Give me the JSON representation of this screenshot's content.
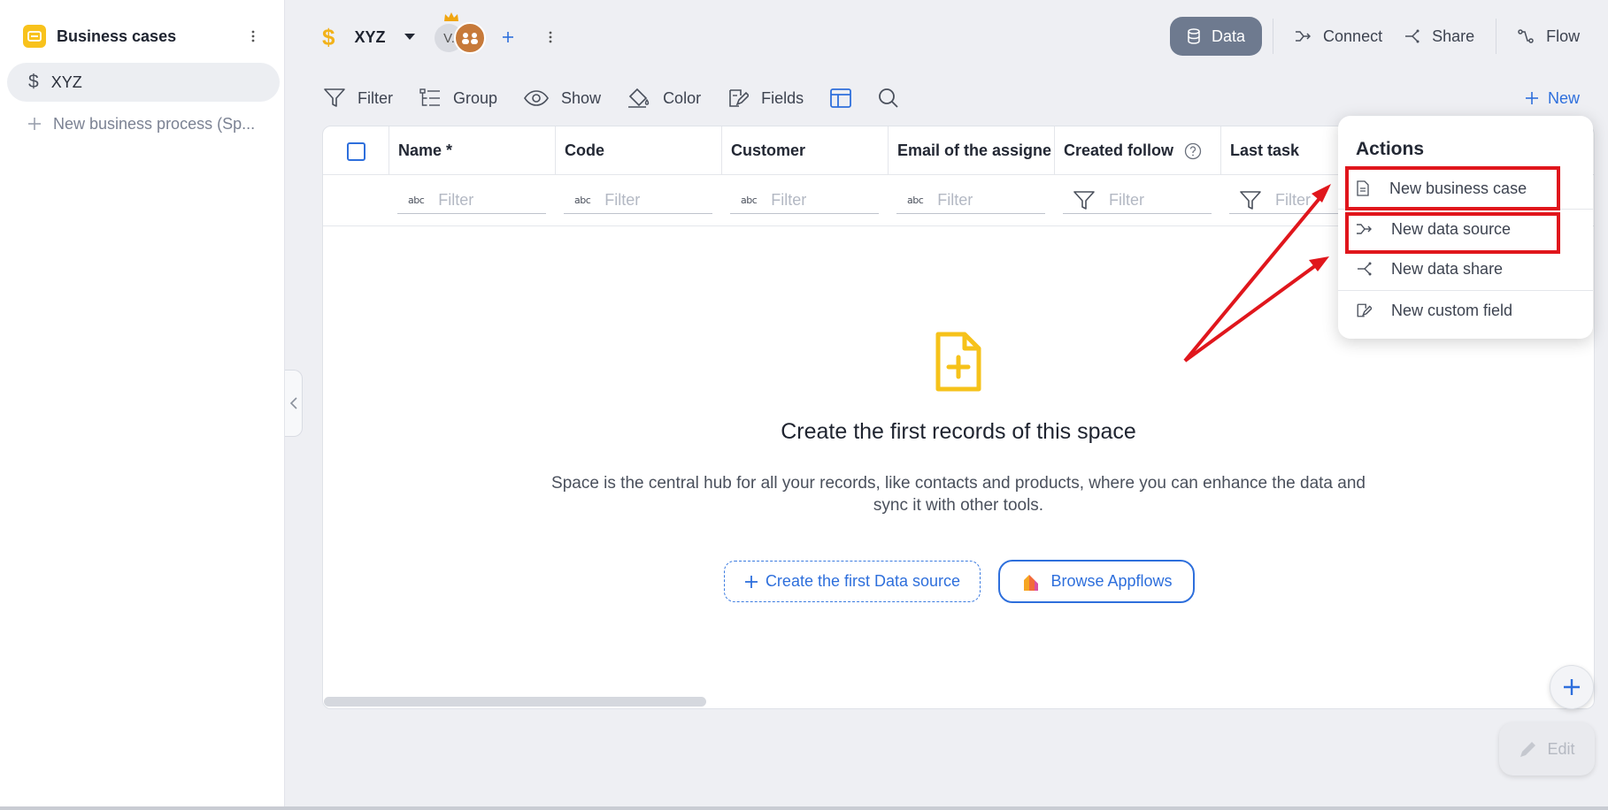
{
  "sidebar": {
    "title": "Business cases",
    "items": [
      {
        "label": "XYZ",
        "icon": "$"
      }
    ],
    "new_item_label": "New business process (Sp..."
  },
  "topbar": {
    "space_icon": "$",
    "space_name": "XYZ",
    "avatar_initial": "V.",
    "tabs": {
      "data": "Data",
      "connect": "Connect",
      "share": "Share",
      "flow": "Flow"
    }
  },
  "toolbar": {
    "filter": "Filter",
    "group": "Group",
    "show": "Show",
    "color": "Color",
    "fields": "Fields",
    "new": "New"
  },
  "table": {
    "columns": [
      "Name *",
      "Code",
      "Customer",
      "Email of the assigne",
      "Created follow",
      "Last task"
    ],
    "filter_placeholder": "Filter",
    "abc_icon_text": "abc"
  },
  "empty_state": {
    "title": "Create the first records of this space",
    "description": "Space is the central hub for all your records, like contacts and products, where you can enhance the data and sync it with other tools.",
    "create_button": "Create the first Data source",
    "browse_button": "Browse Appflows"
  },
  "actions_menu": {
    "title": "Actions",
    "items": [
      "New business case",
      "New data source",
      "New data share",
      "New custom field"
    ]
  },
  "fab": {
    "edit": "Edit"
  },
  "colors": {
    "accent": "#2e6fdc",
    "brand_yellow": "#f8c21c",
    "highlight_red": "#e0161c",
    "data_tab_bg": "#6e7a8f"
  }
}
